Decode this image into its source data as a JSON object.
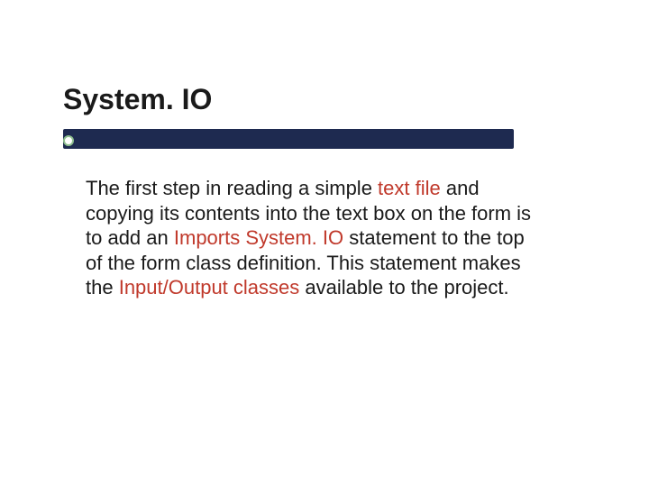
{
  "slide": {
    "title": "System. IO",
    "body": {
      "seg1": "The first step in reading a simple ",
      "hl1": "text file",
      "seg2": " and copying its contents into the text box on the form is to add an ",
      "hl2": "Imports System. IO",
      "seg3": " statement to the top of the form class definition. This statement makes the ",
      "hl3": "Input/Output classes",
      "seg4": " available to the project."
    }
  },
  "colors": {
    "bar": "#1e2a50",
    "highlight": "#c0392b",
    "bullet_ring": "#8fbf8f"
  }
}
